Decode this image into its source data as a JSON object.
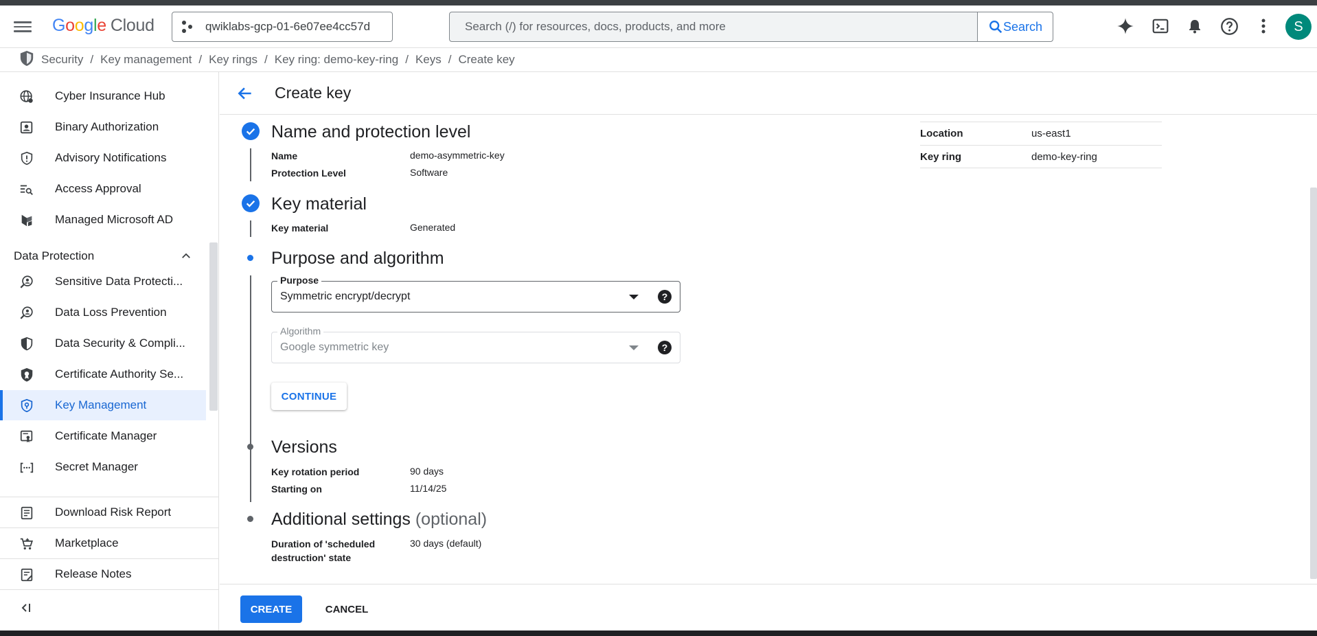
{
  "header": {
    "logo_google": "Google",
    "logo_cloud": "Cloud",
    "project": "qwiklabs-gcp-01-6e07ee4cc57d",
    "search_placeholder": "Search (/) for resources, docs, products, and more",
    "search_button": "Search",
    "avatar_letter": "S"
  },
  "breadcrumb": [
    "Security",
    "Key management",
    "Key rings",
    "Key ring: demo-key-ring",
    "Keys",
    "Create key"
  ],
  "sidebar": {
    "items_top": [
      {
        "label": "Cyber Insurance Hub",
        "icon": "globe-icon"
      },
      {
        "label": "Binary Authorization",
        "icon": "badge-icon"
      },
      {
        "label": "Advisory Notifications",
        "icon": "shield-alert-icon"
      },
      {
        "label": "Access Approval",
        "icon": "list-search-icon"
      },
      {
        "label": "Managed Microsoft AD",
        "icon": "directory-icon"
      }
    ],
    "section_title": "Data Protection",
    "items_section": [
      {
        "label": "Sensitive Data Protecti...",
        "icon": "magnify-person-icon"
      },
      {
        "label": "Data Loss Prevention",
        "icon": "magnify-person-icon"
      },
      {
        "label": "Data Security & Compli...",
        "icon": "shield-half-icon"
      },
      {
        "label": "Certificate Authority Se...",
        "icon": "shield-cert-icon"
      },
      {
        "label": "Key Management",
        "icon": "key-shield-icon",
        "active": true
      },
      {
        "label": "Certificate Manager",
        "icon": "certificate-icon"
      },
      {
        "label": "Secret Manager",
        "icon": "secret-icon"
      }
    ],
    "footer_items": [
      {
        "label": "Download Risk Report",
        "icon": "report-icon"
      },
      {
        "label": "Marketplace",
        "icon": "cart-icon"
      },
      {
        "label": "Release Notes",
        "icon": "notes-icon"
      }
    ],
    "collapse_label": "<|"
  },
  "page": {
    "title": "Create key",
    "steps": {
      "step1_title": "Name and protection level",
      "name_label": "Name",
      "name_value": "demo-asymmetric-key",
      "protection_label": "Protection Level",
      "protection_value": "Software",
      "step2_title": "Key material",
      "material_label": "Key material",
      "material_value": "Generated",
      "step3_title": "Purpose and algorithm",
      "purpose_label": "Purpose",
      "purpose_value": "Symmetric encrypt/decrypt",
      "algorithm_label": "Algorithm",
      "algorithm_value": "Google symmetric key",
      "continue_label": "CONTINUE",
      "step4_title": "Versions",
      "rotation_label": "Key rotation period",
      "rotation_value": "90 days",
      "starting_label": "Starting on",
      "starting_value": "11/14/25",
      "step5_title": "Additional settings",
      "step5_optional": "(optional)",
      "duration_label_1": "Duration of 'scheduled",
      "duration_label_2": "destruction' state",
      "duration_value": "30 days (default)"
    },
    "summary": [
      {
        "key": "Location",
        "value": "us-east1"
      },
      {
        "key": "Key ring",
        "value": "demo-key-ring"
      }
    ],
    "create_label": "CREATE",
    "cancel_label": "CANCEL"
  },
  "colors": {
    "accent": "#1a73e8",
    "active_bg": "#e8f0fe",
    "avatar": "#00897b"
  }
}
